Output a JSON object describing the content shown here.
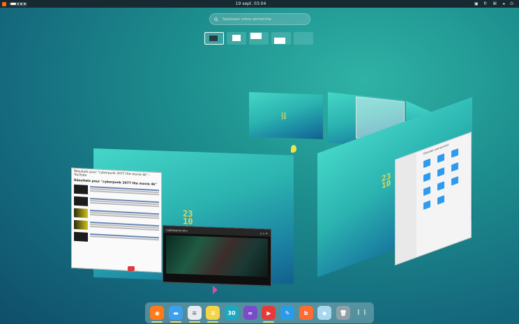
{
  "topbar": {
    "clock": "19 sept. 03:04",
    "tray_battery": "▭",
    "tray_text": "fr"
  },
  "search": {
    "placeholder": "Saisissez votre recherche"
  },
  "desktop_mark": "23\n10",
  "browser": {
    "title": "Résultats pour \"cyberpunk 2077 the movie 4k\" - YouTube",
    "search_text": "Résultats pour \"cyberpunk 2077 the movie 4k\""
  },
  "video": {
    "title": "cyberpunk.mkv"
  },
  "files": {
    "title": "Dossier personnel"
  },
  "dock": {
    "apps": [
      {
        "name": "firefox",
        "color": "#ff7a1a",
        "glyph": "◉",
        "running": true
      },
      {
        "name": "files",
        "color": "#3aa0ef",
        "glyph": "▬",
        "running": true
      },
      {
        "name": "text-editor",
        "color": "#e7ecf0",
        "glyph": "≡",
        "running": true
      },
      {
        "name": "notes",
        "color": "#f5d548",
        "glyph": "≡",
        "running": true
      },
      {
        "name": "calendar",
        "color": "#1ba9c2",
        "glyph": "30",
        "running": false
      },
      {
        "name": "tor",
        "color": "#7b4cc9",
        "glyph": "∞",
        "running": false
      },
      {
        "name": "video-player",
        "color": "#e63a3a",
        "glyph": "▶",
        "running": true
      },
      {
        "name": "editor-blue",
        "color": "#2a9be8",
        "glyph": "✎",
        "running": false
      },
      {
        "name": "b-app",
        "color": "#ff6b30",
        "glyph": "b",
        "running": false
      },
      {
        "name": "mint-app",
        "color": "#a9d7f0",
        "glyph": "◆",
        "running": false
      },
      {
        "name": "trash",
        "color": "#8fa0a8",
        "glyph": "🗑",
        "running": false
      },
      {
        "name": "apps-grid",
        "color": "transparent",
        "glyph": "⋮⋮",
        "running": false
      }
    ]
  }
}
